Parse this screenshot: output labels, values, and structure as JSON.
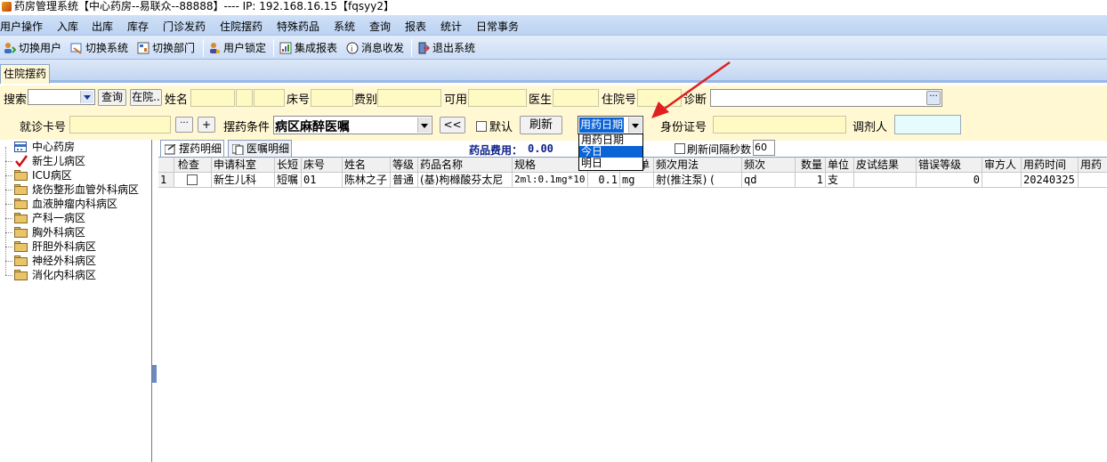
{
  "window": {
    "title": "药房管理系统【中心药房--易联众--88888】---- IP:  192.168.16.15【fqsyy2】"
  },
  "menu": [
    "用户操作",
    "入库",
    "出库",
    "库存",
    "门诊发药",
    "住院摆药",
    "特殊药品",
    "系统",
    "查询",
    "报表",
    "统计",
    "日常事务"
  ],
  "toolbar": [
    {
      "label": "切换用户",
      "icon": "switch-user-icon"
    },
    {
      "label": "切换系统",
      "icon": "switch-system-icon"
    },
    {
      "label": "切换部门",
      "icon": "switch-department-icon"
    },
    {
      "label": "用户锁定",
      "icon": "user-lock-icon"
    },
    {
      "label": "集成报表",
      "icon": "report-icon"
    },
    {
      "label": "消息收发",
      "icon": "message-icon"
    },
    {
      "label": "退出系统",
      "icon": "exit-icon"
    }
  ],
  "main_tab": "住院摆药",
  "filters": {
    "search_label": "搜索",
    "query_button": "查询",
    "inpatient_button": "在院..",
    "name_label": "姓名",
    "bed_label": "床号",
    "fee_type_label": "费别",
    "available_label": "可用",
    "doctor_label": "医生",
    "inpatient_no_label": "住院号",
    "diagnosis_label": "诊断",
    "diagnosis_more": "···",
    "card_label": "就诊卡号",
    "card_more": "···",
    "card_add": "+",
    "condition_label": "摆药条件",
    "condition_value": "病区麻醉医嘱",
    "back_button": "<<",
    "default_label": "默认",
    "refresh_button": "刷新",
    "date_type_selected": "用药日期",
    "date_options": [
      "用药日期",
      "今日",
      "明日"
    ],
    "date_highlight": "今日",
    "id_card_label": "身份证号",
    "dispenser_label": "调剂人"
  },
  "tree": {
    "root": "中心药房",
    "items": [
      "新生儿病区",
      "ICU病区",
      "烧伤整形血管外科病区",
      "血液肿瘤内科病区",
      "产科一病区",
      "胸外科病区",
      "肝胆外科病区",
      "神经外科病区",
      "消化内科病区"
    ],
    "selected": "新生儿病区"
  },
  "subtabs": {
    "detail": "摆药明细",
    "orders": "医嘱明细"
  },
  "summary": {
    "label": "药品费用：",
    "value": "0.00"
  },
  "refresh_interval": {
    "label": "刷新间隔秒数",
    "value": "60"
  },
  "table": {
    "headers": [
      "检查",
      "申请科室",
      "长短",
      "床号",
      "姓名",
      "等级",
      "药品名称",
      "规格",
      "",
      "单",
      "频次用法",
      "频次",
      "数量",
      "单位",
      "皮试结果",
      "错误等级",
      "审方人",
      "用药时间",
      "用药"
    ],
    "rows": [
      {
        "no": "1",
        "dept": "新生儿科",
        "duration": "短嘱",
        "bed": "01",
        "name": "陈林之子",
        "level": "普通",
        "drug": "(基)枸橼酸芬太尼",
        "spec": "2ml:0.1mg*10",
        "dose": "0.1",
        "unit": "mg",
        "usage": "射(推注泵) (",
        "freq": "qd",
        "qty": "1",
        "qty_unit": "支",
        "skin_test": "",
        "error_level": "0",
        "reviewer": "",
        "time": "20240325"
      }
    ]
  },
  "colors": {
    "accent": "#cfe0f7",
    "filter_bg": "#fff8d3",
    "field_yellow": "#fff9c4",
    "annotation_arrow": "#e02020",
    "select_highlight": "#0a64d8"
  }
}
